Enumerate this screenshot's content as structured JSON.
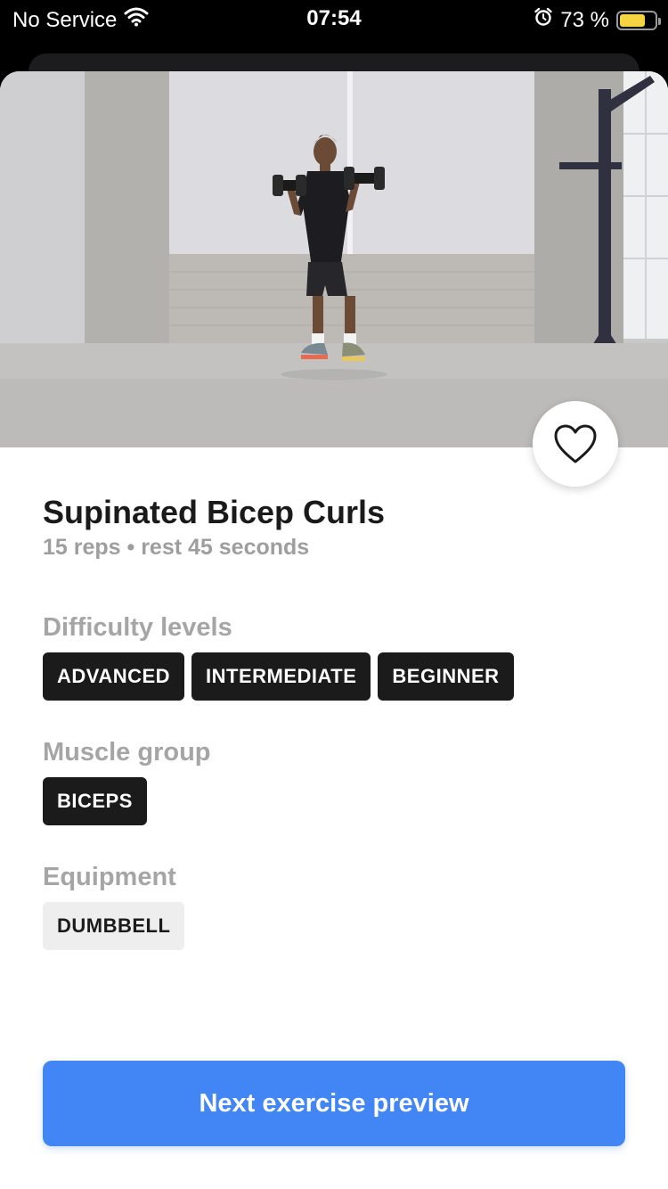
{
  "status_bar": {
    "carrier": "No Service",
    "time": "07:54",
    "battery_percent": "73 %",
    "battery_level": 0.73
  },
  "exercise": {
    "title": "Supinated Bicep Curls",
    "subtitle": "15 reps • rest 45 seconds"
  },
  "sections": {
    "difficulty": {
      "label": "Difficulty levels",
      "tags": [
        "ADVANCED",
        "INTERMEDIATE",
        "BEGINNER"
      ]
    },
    "muscle": {
      "label": "Muscle group",
      "tags": [
        "BICEPS"
      ]
    },
    "equipment": {
      "label": "Equipment",
      "tags": [
        "DUMBBELL"
      ]
    }
  },
  "cta": {
    "label": "Next exercise preview"
  },
  "icons": {
    "favorite": "heart-outline-icon",
    "wifi": "wifi-icon",
    "alarm": "alarm-icon",
    "battery": "battery-icon"
  },
  "colors": {
    "accent": "#4285f4",
    "tag_dark": "#1b1b1b",
    "tag_light": "#eeeeee",
    "battery": "#f5d442"
  }
}
